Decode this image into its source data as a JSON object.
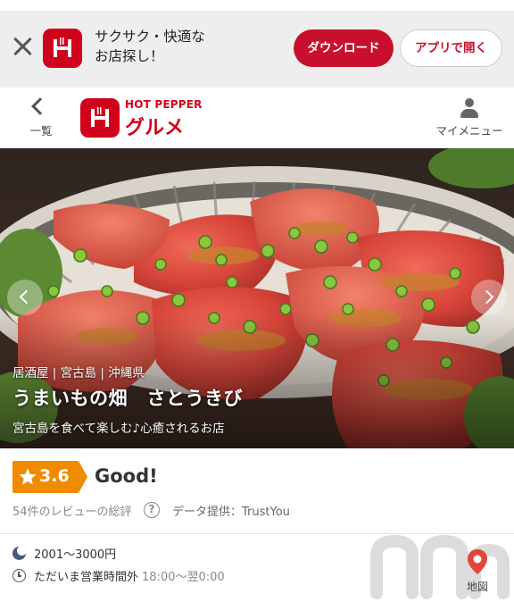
{
  "app_banner": {
    "line1": "サクサク・快適な",
    "line2": "お店探し！",
    "download_label": "ダウンロード",
    "open_app_label": "アプリで開く"
  },
  "header": {
    "back_label": "一覧",
    "logo_top": "HOT PEPPER",
    "logo_main": "グルメ",
    "mymenu_label": "マイメニュー"
  },
  "hero": {
    "genre": "居酒屋 | 宮古島 | 沖縄県",
    "shop_name": "うまいもの畑　さとうきび",
    "catch_copy": "宮古島を食べて楽しむ♪心癒されるお店"
  },
  "rating": {
    "score": "3.6",
    "word": "Good!",
    "summary": "54件のレビューの総評",
    "help_symbol": "?",
    "provider_label": "データ提供：",
    "provider_name": "TrustYou"
  },
  "info": {
    "budget": "2001～3000円",
    "hours_status": "ただいま営業時間外",
    "hours_time": "18:00～翌0:00",
    "map_label": "地図"
  },
  "colors": {
    "brand_red": "#d0021b",
    "rating_orange": "#f08a00"
  },
  "icons": [
    "close-icon",
    "h-logo-icon",
    "back-chevron-icon",
    "person-icon",
    "star-icon",
    "help-icon",
    "moon-icon",
    "clock-icon",
    "map-pin-icon"
  ]
}
